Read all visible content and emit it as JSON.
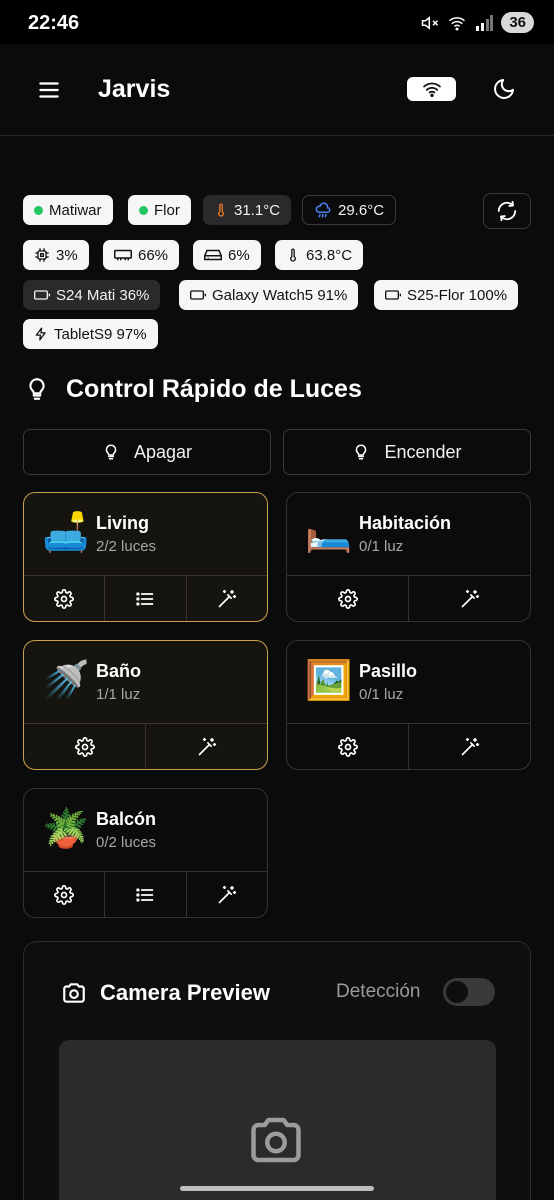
{
  "status_bar": {
    "time": "22:46",
    "battery": "36"
  },
  "header": {
    "title": "Jarvis"
  },
  "chips": {
    "matiwar": "Matiwar",
    "flor": "Flor",
    "temp_in": "31.1°C",
    "temp_out": "29.6°C",
    "cpu": "3%",
    "ram": "66%",
    "disk": "6%",
    "cpu_temp": "63.8°C",
    "s24": "S24 Mati 36%",
    "watch": "Galaxy Watch5 91%",
    "s25": "S25-Flor 100%",
    "tablet": "TabletS9 97%"
  },
  "colors": {
    "accent_on": "#c9a24e",
    "online": "#22c55e",
    "temp_icon": "#f07c2a",
    "weather_icon": "#4b7ff0"
  },
  "lights": {
    "title": "Control Rápido de Luces",
    "off_label": "Apagar",
    "on_label": "Encender",
    "rooms": [
      {
        "name": "Living",
        "count": "2/2 luces",
        "emoji": "🛋️",
        "on": true
      },
      {
        "name": "Habitación",
        "count": "0/1 luz",
        "emoji": "🛏️",
        "on": false
      },
      {
        "name": "Baño",
        "count": "1/1 luz",
        "emoji": "🚿",
        "on": true
      },
      {
        "name": "Pasillo",
        "count": "0/1 luz",
        "emoji": "🖼️",
        "on": false
      },
      {
        "name": "Balcón",
        "count": "0/2 luces",
        "emoji": "🪴",
        "on": false
      }
    ]
  },
  "camera": {
    "title": "Camera Preview",
    "detection_label": "Detección",
    "detection_on": false
  }
}
